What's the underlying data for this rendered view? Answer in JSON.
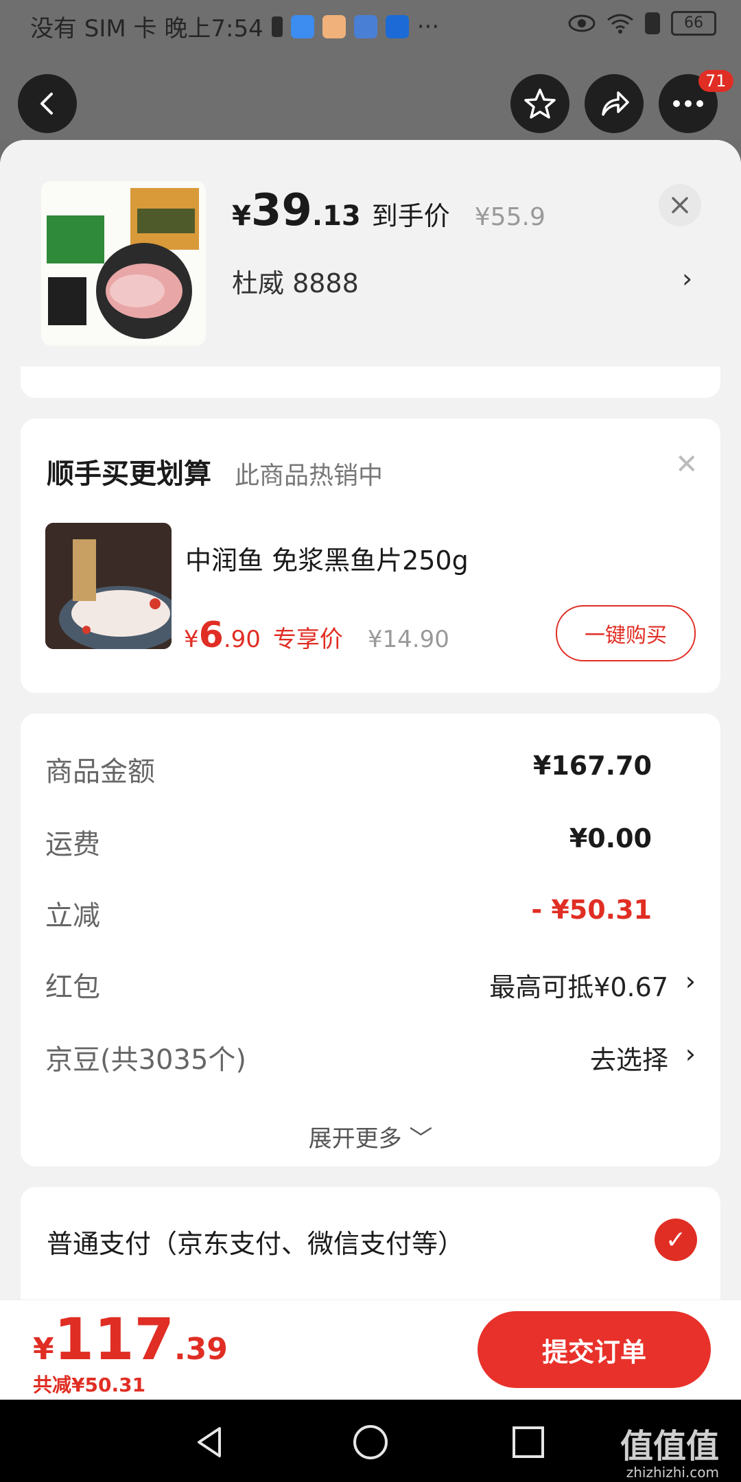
{
  "status_bar": {
    "carrier_time": "没有 SIM 卡 晚上7:54",
    "more": "···",
    "battery": "66"
  },
  "nav": {
    "badge_count": "71"
  },
  "product": {
    "currency": "¥",
    "price_int": "39",
    "price_dec": ".13",
    "final_label": "到手价",
    "original_price": "¥55.9",
    "spec": "杜威  8888"
  },
  "upsell": {
    "title": "顺手买更划算",
    "subtitle": "此商品热销中",
    "item_name": "中润鱼 免浆黑鱼片250g",
    "currency": "¥",
    "price_int": "6",
    "price_dec": ".90",
    "price_tag": "专享价",
    "original_price": "¥14.90",
    "buy_label": "一键购买"
  },
  "summary": {
    "rows": [
      {
        "label": "商品金额",
        "value": "¥167.70"
      },
      {
        "label": "运费",
        "value": "¥0.00"
      },
      {
        "label": "立减",
        "value": "- ¥50.31"
      },
      {
        "label": "红包",
        "value": "最高可抵¥0.67"
      },
      {
        "label": "京豆(共3035个)",
        "value": "去选择"
      }
    ],
    "expand_label": "展开更多"
  },
  "payment": {
    "method": "普通支付（京东支付、微信支付等）"
  },
  "order": {
    "currency": "¥",
    "total_int": "117",
    "total_dec": ".39",
    "saved": "共减¥50.31",
    "submit_label": "提交订单"
  },
  "watermark": {
    "text": "值值值",
    "domain": "zhizhizhi.com"
  },
  "colors": {
    "accent_red": "#e02e24",
    "overlay_gray": "#6f6f6f"
  }
}
